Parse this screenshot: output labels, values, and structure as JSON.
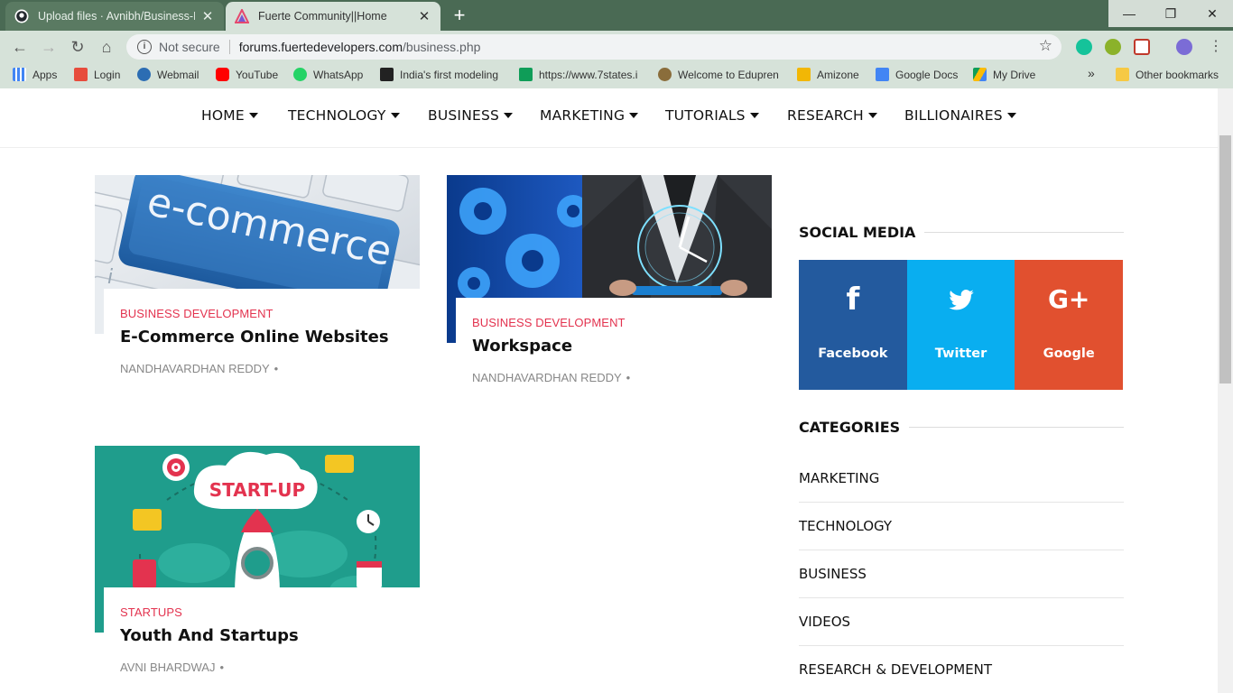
{
  "browser": {
    "tabs": [
      {
        "title": "Upload files · Avnibh/Business-Bl",
        "active": false,
        "icon": "github-icon"
      },
      {
        "title": "Fuerte Community||Home",
        "active": true,
        "icon": "fuerte-logo-icon"
      }
    ],
    "address": {
      "security_label": "Not secure",
      "host": "forums.fuertedevelopers.com",
      "path": "/business.php"
    },
    "bookmarks": [
      {
        "label": "Apps",
        "icon": "apps-grid-icon",
        "color": "#4285f4"
      },
      {
        "label": "Login",
        "icon": "login-icon",
        "color": "#e74c3c"
      },
      {
        "label": "Webmail",
        "icon": "webmail-icon",
        "color": "#2c6db3"
      },
      {
        "label": "YouTube",
        "icon": "youtube-icon",
        "color": "#ff0000"
      },
      {
        "label": "WhatsApp",
        "icon": "whatsapp-icon",
        "color": "#25d366"
      },
      {
        "label": "India's first modeling",
        "icon": "seven-icon",
        "color": "#222222"
      },
      {
        "label": "https://www.7states.i",
        "icon": "sheets-icon",
        "color": "#0f9d58"
      },
      {
        "label": "Welcome to Edupren",
        "icon": "edupren-icon",
        "color": "#8a6d3b"
      },
      {
        "label": "Amizone",
        "icon": "amizone-icon",
        "color": "#f2b705"
      },
      {
        "label": "Google Docs",
        "icon": "docs-icon",
        "color": "#4285f4"
      },
      {
        "label": "My Drive",
        "icon": "drive-icon",
        "color": "#fbbc04"
      }
    ],
    "overflow_label": "»",
    "other_bookmarks": "Other bookmarks"
  },
  "nav": {
    "items": [
      "HOME",
      "TECHNOLOGY",
      "BUSINESS",
      "MARKETING",
      "TUTORIALS",
      "RESEARCH",
      "BILLIONAIRES"
    ]
  },
  "posts": [
    {
      "category": "BUSINESS DEVELOPMENT",
      "title": "E-Commerce Online Websites",
      "author": "NANDHAVARDHAN REDDY",
      "image_text": "e-commerce"
    },
    {
      "category": "BUSINESS DEVELOPMENT",
      "title": "Workspace",
      "author": "NANDHAVARDHAN REDDY"
    },
    {
      "category": "STARTUPS",
      "title": "Youth And Startups",
      "author": "AVNI BHARDWAJ",
      "image_text": "START-UP"
    }
  ],
  "sidebar": {
    "social_heading": "SOCIAL MEDIA",
    "social": [
      {
        "label": "Facebook",
        "glyph": "f",
        "color": "#235a9e"
      },
      {
        "label": "Twitter",
        "glyph": "t",
        "color": "#09aef0"
      },
      {
        "label": "Google",
        "glyph": "G+",
        "color": "#e1502f"
      }
    ],
    "categories_heading": "CATEGORIES",
    "categories": [
      "MARKETING",
      "TECHNOLOGY",
      "BUSINESS",
      "VIDEOS",
      "RESEARCH & DEVELOPMENT"
    ]
  }
}
